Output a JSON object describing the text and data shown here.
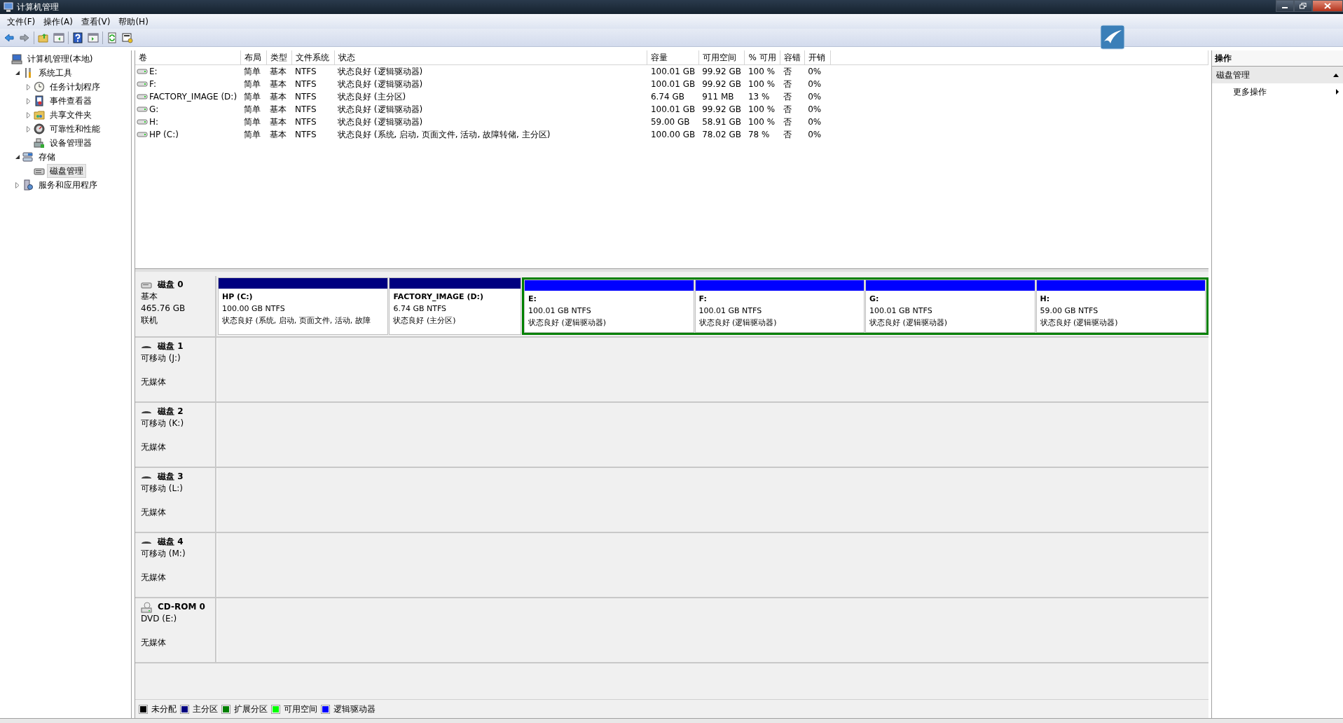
{
  "window": {
    "title": "计算机管理"
  },
  "menu": [
    "文件(F)",
    "操作(A)",
    "查看(V)",
    "帮助(H)"
  ],
  "tree": [
    {
      "label": "计算机管理(本地)",
      "selected": false,
      "children": [
        {
          "label": "系统工具",
          "expanded": true,
          "selected": false,
          "children": [
            {
              "label": "任务计划程序",
              "expanded": false,
              "selected": false
            },
            {
              "label": "事件查看器",
              "expanded": false,
              "selected": false
            },
            {
              "label": "共享文件夹",
              "expanded": false,
              "selected": false
            },
            {
              "label": "可靠性和性能",
              "expanded": false,
              "selected": false
            },
            {
              "label": "设备管理器",
              "selected": false
            }
          ]
        },
        {
          "label": "存储",
          "expanded": true,
          "selected": false,
          "children": [
            {
              "label": "磁盘管理",
              "selected": true
            }
          ]
        },
        {
          "label": "服务和应用程序",
          "expanded": false,
          "selected": false
        }
      ]
    }
  ],
  "table": {
    "columns": [
      "卷",
      "布局",
      "类型",
      "文件系统",
      "状态",
      "容量",
      "可用空间",
      "% 可用",
      "容错",
      "开销"
    ],
    "rows": [
      [
        "E:",
        "简单",
        "基本",
        "NTFS",
        "状态良好 (逻辑驱动器)",
        "100.01 GB",
        "99.92 GB",
        "100 %",
        "否",
        "0%"
      ],
      [
        "F:",
        "简单",
        "基本",
        "NTFS",
        "状态良好 (逻辑驱动器)",
        "100.01 GB",
        "99.92 GB",
        "100 %",
        "否",
        "0%"
      ],
      [
        "FACTORY_IMAGE (D:)",
        "简单",
        "基本",
        "NTFS",
        "状态良好 (主分区)",
        "6.74 GB",
        "911 MB",
        "13 %",
        "否",
        "0%"
      ],
      [
        "G:",
        "简单",
        "基本",
        "NTFS",
        "状态良好 (逻辑驱动器)",
        "100.01 GB",
        "99.92 GB",
        "100 %",
        "否",
        "0%"
      ],
      [
        "H:",
        "简单",
        "基本",
        "NTFS",
        "状态良好 (逻辑驱动器)",
        "59.00 GB",
        "58.91 GB",
        "100 %",
        "否",
        "0%"
      ],
      [
        "HP (C:)",
        "简单",
        "基本",
        "NTFS",
        "状态良好 (系统, 启动, 页面文件, 活动, 故障转储, 主分区)",
        "100.00 GB",
        "78.02 GB",
        "78 %",
        "否",
        "0%"
      ]
    ]
  },
  "disks": [
    {
      "name": "磁盘 0",
      "kind": "basic",
      "type": "基本",
      "size": "465.76 GB",
      "status": "联机",
      "partitions": [
        {
          "kind": "primary",
          "title": "HP  (C:)",
          "detail": "100.00 GB NTFS",
          "status": "状态良好 (系统, 启动, 页面文件, 活动, 故障"
        },
        {
          "kind": "primary",
          "title": "FACTORY_IMAGE  (D:)",
          "detail": "6.74 GB NTFS",
          "status": "状态良好 (主分区)"
        },
        {
          "kind": "extended",
          "children": [
            {
              "kind": "logical",
              "title": "E:",
              "detail": "100.01 GB NTFS",
              "status": "状态良好 (逻辑驱动器)"
            },
            {
              "kind": "logical",
              "title": "F:",
              "detail": "100.01 GB NTFS",
              "status": "状态良好 (逻辑驱动器)"
            },
            {
              "kind": "logical",
              "title": "G:",
              "detail": "100.01 GB NTFS",
              "status": "状态良好 (逻辑驱动器)"
            },
            {
              "kind": "logical",
              "title": "H:",
              "detail": "59.00 GB NTFS",
              "status": "状态良好 (逻辑驱动器)"
            }
          ]
        }
      ]
    },
    {
      "name": "磁盘 1",
      "kind": "removable",
      "type": "可移动 (J:)",
      "status": "无媒体"
    },
    {
      "name": "磁盘 2",
      "kind": "removable",
      "type": "可移动 (K:)",
      "status": "无媒体"
    },
    {
      "name": "磁盘 3",
      "kind": "removable",
      "type": "可移动 (L:)",
      "status": "无媒体"
    },
    {
      "name": "磁盘 4",
      "kind": "removable",
      "type": "可移动 (M:)",
      "status": "无媒体"
    },
    {
      "name": "CD-ROM 0",
      "kind": "cdrom",
      "type": "DVD (E:)",
      "status": "无媒体"
    }
  ],
  "legend": [
    {
      "label": "未分配",
      "color": "#000000"
    },
    {
      "label": "主分区",
      "color": "#000080"
    },
    {
      "label": "扩展分区",
      "color": "#008000"
    },
    {
      "label": "可用空间",
      "color": "#00ff00"
    },
    {
      "label": "逻辑驱动器",
      "color": "#0000ff"
    }
  ],
  "actions": {
    "title": "操作",
    "sections": [
      {
        "label": "磁盘管理",
        "expanded": true,
        "items": [
          "更多操作"
        ]
      }
    ]
  }
}
